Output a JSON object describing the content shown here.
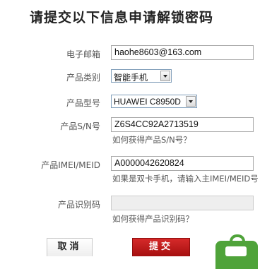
{
  "title": "请提交以下信息申请解锁密码",
  "form": {
    "email": {
      "label": "电子邮箱",
      "value": "haohe8603@163.com"
    },
    "category": {
      "label": "产品类别",
      "selected": "智能手机"
    },
    "model": {
      "label": "产品型号",
      "selected": "HUAWEI C8950D"
    },
    "serial": {
      "label": "产品S/N号",
      "value": "Z6S4CC92A2713519",
      "help": "如何获得产品S/N号？"
    },
    "imei": {
      "label": "产品IMEI/MEID",
      "value": "A0000042620824",
      "help": "如果是双卡手机，请输入主IMEI/MEID号"
    },
    "product_code": {
      "label": "产品识别码",
      "value": "",
      "help": "如何获得产品识别码？"
    }
  },
  "buttons": {
    "cancel": "取消",
    "submit": "提交"
  },
  "badge": {
    "icon": "shopping-bag-icon",
    "color": "#4fa33a"
  }
}
